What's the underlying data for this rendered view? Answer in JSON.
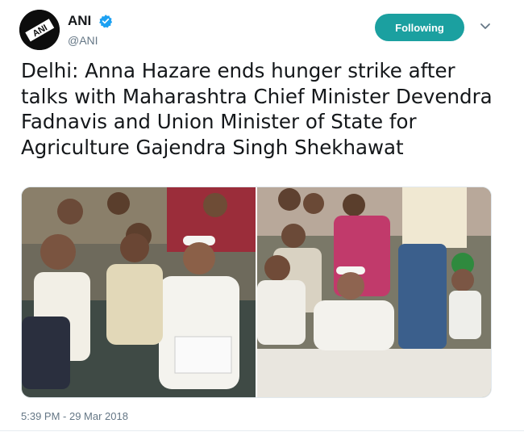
{
  "account": {
    "display_name": "ANI",
    "handle": "@ANI",
    "verified": true,
    "avatar_text": "ANI"
  },
  "follow_button": {
    "label": "Following",
    "color": "#1ba0a0"
  },
  "tweet": {
    "text": "Delhi: Anna Hazare ends hunger strike after talks with Maharashtra Chief Minister Devendra Fadnavis and Union Minister of State for Agriculture Gajendra Singh Shekhawat",
    "timestamp": "5:39 PM - 29 Mar 2018"
  },
  "media": {
    "photo_count": 2
  },
  "colors": {
    "text": "#14171a",
    "muted": "#657786",
    "verified": "#1da1f2"
  }
}
